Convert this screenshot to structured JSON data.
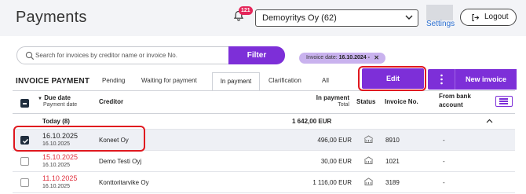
{
  "header": {
    "title": "Payments",
    "notification_count": "121",
    "company": "Demoyritys Oy (62)",
    "settings_label": "Settings",
    "logout_label": "Logout"
  },
  "search": {
    "placeholder": "Search for invoices by creditor name or invoice No.",
    "value": "",
    "filter_label": "Filter"
  },
  "active_filter": {
    "label": "Invoice date:",
    "value": "16.10.2024 -",
    "remove": "✕"
  },
  "section": {
    "title": "INVOICE PAYMENT"
  },
  "tabs": [
    {
      "label": "Pending"
    },
    {
      "label": "Waiting for payment"
    },
    {
      "label": "In payment"
    },
    {
      "label": "Clarification"
    },
    {
      "label": "All"
    }
  ],
  "actions": {
    "edit_label": "Edit",
    "more_label": "⋮",
    "new_invoice_label": "New invoice"
  },
  "table": {
    "headers": {
      "due_date": "Due date",
      "payment_date": "Payment date",
      "creditor": "Creditor",
      "in_payment": "In payment",
      "total": "Total",
      "status": "Status",
      "invoice_no": "Invoice No.",
      "from_bank_line1": "From bank",
      "from_bank_line2": "account"
    },
    "group": {
      "label": "Today (8)",
      "total": "1 642,00 EUR"
    },
    "rows": [
      {
        "due_date": "16.10.2025",
        "payment_date": "16.10.2025",
        "creditor": "Koneet Oy",
        "amount": "496,00 EUR",
        "invoice_no": "8910",
        "from_bank": "-",
        "checked": true,
        "overdue": false
      },
      {
        "due_date": "15.10.2025",
        "payment_date": "16.10.2025",
        "creditor": "Demo Testi Oyj",
        "amount": "30,00 EUR",
        "invoice_no": "1021",
        "from_bank": "-",
        "checked": false,
        "overdue": true
      },
      {
        "due_date": "11.10.2025",
        "payment_date": "16.10.2025",
        "creditor": "Konttoritarvike Oy",
        "amount": "1 116,00 EUR",
        "invoice_no": "3189",
        "from_bank": "-",
        "checked": false,
        "overdue": true
      }
    ]
  },
  "colors": {
    "accent": "#7d2fd8",
    "highlight": "#e0181f",
    "overdue": "#e0303e",
    "badge": "#e5265a"
  }
}
